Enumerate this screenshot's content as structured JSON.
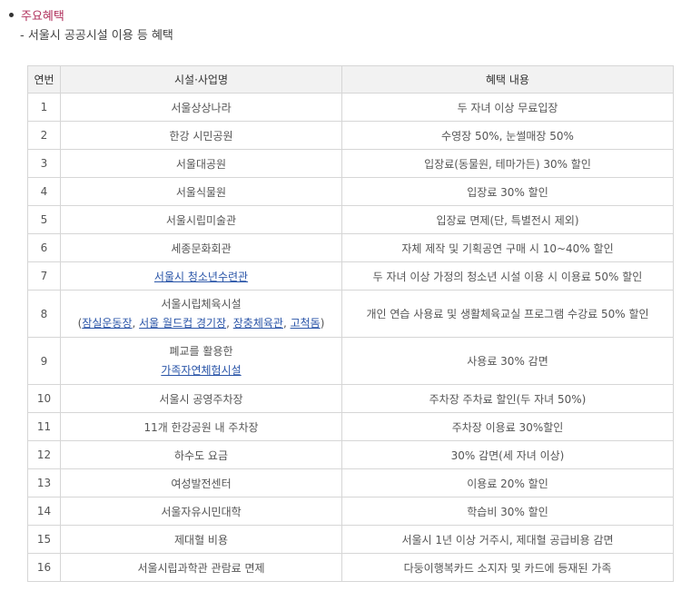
{
  "section": {
    "title": "주요혜택",
    "subtitle": "- 서울시 공공시설 이용 등 혜택"
  },
  "table": {
    "headers": [
      "연번",
      "시설·사업명",
      "혜택 내용"
    ],
    "rows": [
      {
        "no": "1",
        "facility": "서울상상나라",
        "benefit": "두 자녀 이상 무료입장"
      },
      {
        "no": "2",
        "facility": "한강 시민공원",
        "benefit": "수영장 50%, 눈썰매장 50%"
      },
      {
        "no": "3",
        "facility": "서울대공원",
        "benefit": "입장료(동물원, 테마가든) 30% 할인"
      },
      {
        "no": "4",
        "facility": "서울식물원",
        "benefit": "입장료 30% 할인"
      },
      {
        "no": "5",
        "facility": "서울시립미술관",
        "benefit": "입장료 면제(단, 특별전시 제외)"
      },
      {
        "no": "6",
        "facility": "세종문화회관",
        "benefit": "자체 제작 및 기획공연 구매 시 10~40% 할인"
      },
      {
        "no": "7",
        "facility": "서울시 청소년수련관",
        "benefit": "두 자녀 이상 가정의 청소년 시설 이용 시 이용료 50% 할인"
      },
      {
        "no": "8",
        "facility": "서울시립체육시설",
        "facility_sub": {
          "open": "(",
          "links": [
            "잠실운동장",
            "서울 월드컵 경기장",
            "장충체육관",
            "고척돔"
          ],
          "sep": ", ",
          "close": ")"
        },
        "benefit": "개인 연습 사용료 및 생활체육교실 프로그램 수강료 50% 할인"
      },
      {
        "no": "9",
        "facility": "폐교를 활용한",
        "facility_link": "가족자연체험시설",
        "benefit": "사용료 30% 감면"
      },
      {
        "no": "10",
        "facility": "서울시 공영주차장",
        "benefit": "주차장 주차료 할인(두 자녀 50%)"
      },
      {
        "no": "11",
        "facility": "11개 한강공원 내 주차장",
        "benefit": "주차장 이용료 30%할인"
      },
      {
        "no": "12",
        "facility": "하수도 요금",
        "benefit": "30% 감면(세 자녀 이상)"
      },
      {
        "no": "13",
        "facility": "여성발전센터",
        "benefit": "이용료 20% 할인"
      },
      {
        "no": "14",
        "facility": "서울자유시민대학",
        "benefit": "학습비 30% 할인"
      },
      {
        "no": "15",
        "facility": "제대혈 비용",
        "benefit": "서울시 1년 이상 거주시, 제대혈 공급비용 감면"
      },
      {
        "no": "16",
        "facility": "서울시립과학관 관람료 면제",
        "benefit": "다둥이행복카드 소지자 및 카드에 등재된 가족"
      }
    ]
  },
  "colors": {
    "title": "#b0305c",
    "link": "#2a55a8",
    "header_bg": "#f2f2f2",
    "border": "#d6d6d6"
  }
}
